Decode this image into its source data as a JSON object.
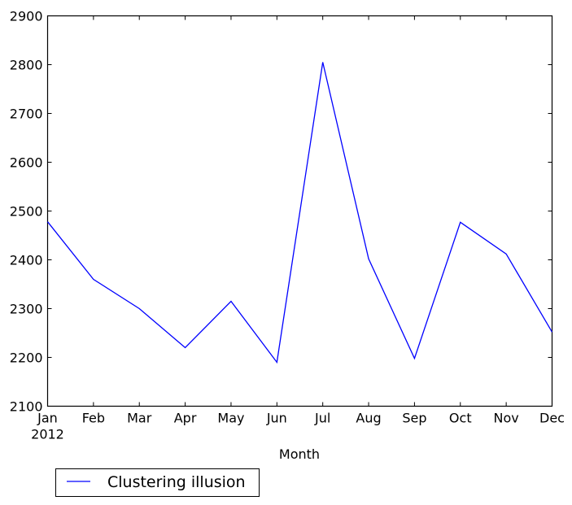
{
  "chart_data": {
    "type": "line",
    "title": "",
    "xlabel": "Month",
    "ylabel": "",
    "categories": [
      "Jan",
      "Feb",
      "Mar",
      "Apr",
      "May",
      "Jun",
      "Jul",
      "Aug",
      "Sep",
      "Oct",
      "Nov",
      "Dec"
    ],
    "x_sublabel": "2012",
    "yticks": [
      2100,
      2200,
      2300,
      2400,
      2500,
      2600,
      2700,
      2800,
      2900
    ],
    "ylim": [
      2100,
      2900
    ],
    "grid": false,
    "legend_position": "below-left",
    "series": [
      {
        "name": "Clustering illusion",
        "color": "#0000ff",
        "values": [
          2478,
          2360,
          2300,
          2220,
          2315,
          2190,
          2805,
          2402,
          2198,
          2477,
          2412,
          2252
        ]
      }
    ]
  }
}
